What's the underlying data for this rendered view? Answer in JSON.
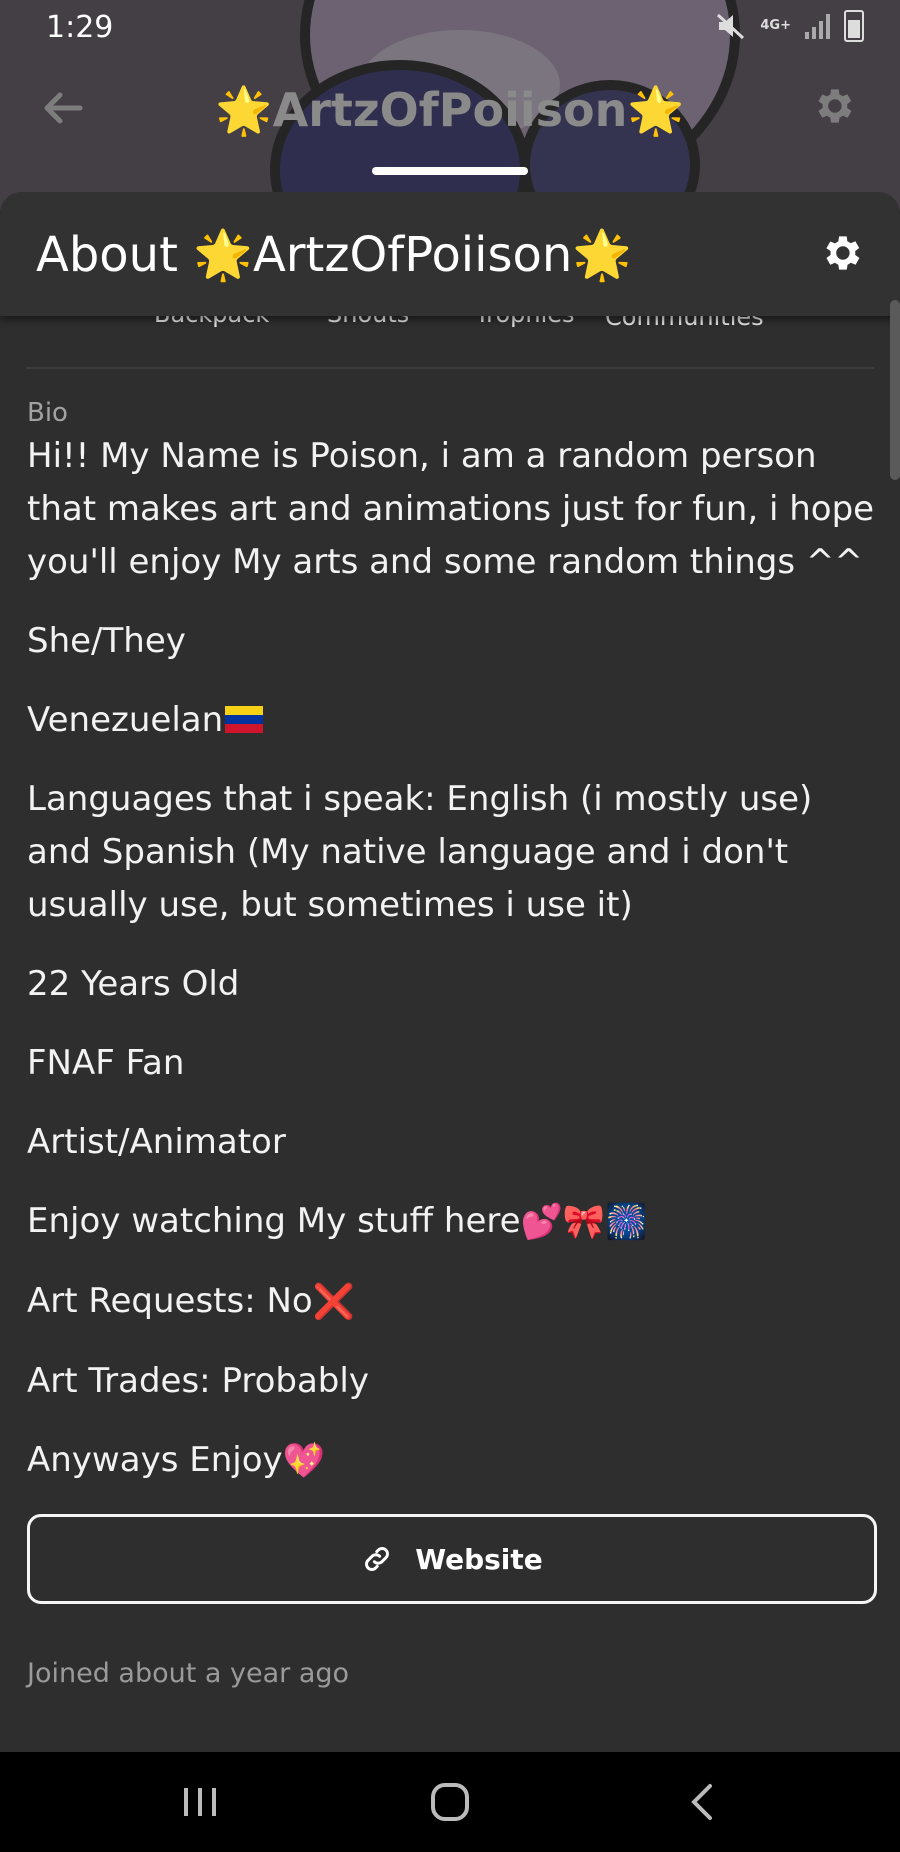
{
  "status_bar": {
    "time": "1:29",
    "network": "4G+"
  },
  "top_bar": {
    "title": "🌟ArtzOfPoiison🌟"
  },
  "sheet": {
    "title": "About 🌟ArtzOfPoiison🌟",
    "tabs": [
      "Backpack",
      "Shouts",
      "Trophies",
      "Communities"
    ]
  },
  "bio": {
    "label": "Bio",
    "lines": [
      "Hi!! My Name is Poison, i am a random person that makes art and animations just for fun, i hope you'll enjoy My arts and some random things ^^",
      "She/They",
      "Venezuelan",
      "Languages that i speak: English (i mostly use) and Spanish (My native language and i don't usually use, but sometimes i use it)",
      "22 Years Old",
      "FNAF Fan",
      "Artist/Animator",
      "Enjoy watching My stuff here",
      "Art Requests: No",
      "Art Trades: Probably",
      "Anyways Enjoy"
    ],
    "emojis": {
      "enjoy_stuff": "💕🎀🎆",
      "requests": "❌",
      "anyways": "💖"
    }
  },
  "website_button": {
    "label": "Website"
  },
  "joined": "Joined about a year ago",
  "colors": {
    "flag_yellow": "#f7d116",
    "flag_blue": "#0033a0",
    "flag_red": "#cf142b"
  }
}
